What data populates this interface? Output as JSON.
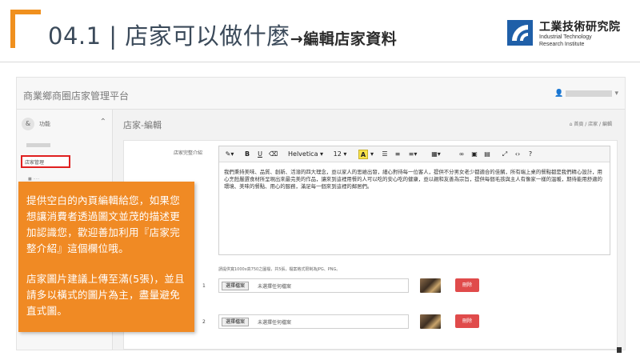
{
  "slide": {
    "title_main": "04.1 | 店家可以做什麼",
    "title_sub": "→編輯店家資料"
  },
  "org": {
    "name_zh": "工業技術研究院",
    "name_en_1": "Industrial Technology",
    "name_en_2": "Research Institute",
    "logo_color": "#1f5fa8"
  },
  "app": {
    "title": "商業鄉商圈店家管理平台",
    "user_caret": "▾",
    "sidebar": {
      "func_label": "功能",
      "active_item": "店家管理"
    },
    "page_title": "店家-編輯",
    "breadcrumb": "首頁 / 店家 / 編輯",
    "editor": {
      "field_label": "店家完整介紹",
      "toolbar": {
        "font": "Helvetica",
        "size": "12",
        "bold": "B",
        "underline": "U",
        "help": "?"
      },
      "body_text": "我們秉持美味、品質、創新、活潑的四大理念，並以家人的思維出發，細心對待每一位客人，提供不分男女老少都適合的佳餚，所有端上桌的餐點都是我們精心設計，用心烹飪嚴選食材所呈現出來最完美的作品，讓來到這裡用餐的人可以吃的安心吃的健康，並以親和友善為宗旨，提供每個毛孩與主人有像家一樣的溫暖，期待能用舒適的環境、美味的餐點、用心的服務，滿足每一個來到這裡的鄰居們。"
    },
    "upload_note": "請提供寬1000x高750之圖檔，共5張，檔案格式限制為JPG、PNG。",
    "uploads": [
      {
        "num": "1",
        "button": "選擇檔案",
        "status": "未選擇任何檔案",
        "delete": "刪除"
      },
      {
        "num": "2",
        "button": "選擇檔案",
        "status": "未選擇任何檔案",
        "delete": "刪除"
      }
    ]
  },
  "callout": {
    "para1": "提供空白的內頁編輯給您，如果您想讓消費者透過圖文並茂的描述更加認識您，歡迎善加利用『店家完整介紹』這個欄位哦。",
    "para2": "店家圖片建議上傳至滿(5張)，並且請多以橫式的圖片為主，盡量避免直式圖。"
  },
  "colors": {
    "accent_orange": "#f08a24",
    "bracket_orange": "#f0901e",
    "highlight_red": "#e02020",
    "delete_red": "#e04b4b"
  }
}
